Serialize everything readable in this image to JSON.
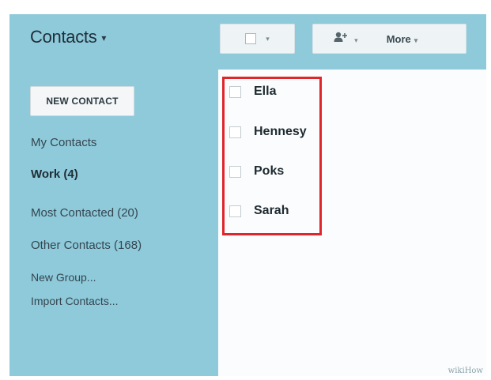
{
  "header": {
    "title": "Contacts",
    "title_caret": "▾",
    "select_caret": "▾",
    "group_icon": "add-person-icon",
    "group_caret": "▾",
    "more_label": "More",
    "more_caret": "▾"
  },
  "sidebar": {
    "new_contact": "NEW CONTACT",
    "items": [
      {
        "label": "My Contacts",
        "bold": false
      },
      {
        "label": "Work (4)",
        "bold": true
      },
      {
        "label": "Most Contacted (20)",
        "bold": false
      },
      {
        "label": "Other Contacts (168)",
        "bold": false
      },
      {
        "label": "New Group...",
        "bold": false
      },
      {
        "label": "Import Contacts...",
        "bold": false
      }
    ]
  },
  "contacts": [
    {
      "name": "Ella"
    },
    {
      "name": "Hennesy"
    },
    {
      "name": "Poks"
    },
    {
      "name": "Sarah"
    }
  ],
  "watermark": "wikiHow",
  "colors": {
    "sidebar": "#8fcadb",
    "highlight": "#e0262b"
  }
}
